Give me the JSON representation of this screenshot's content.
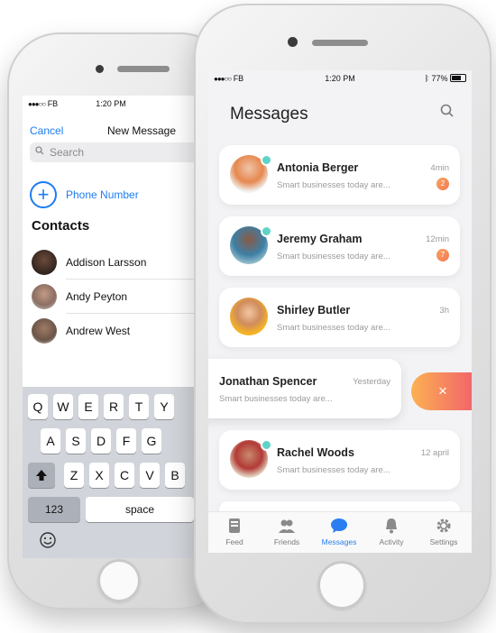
{
  "new_message": {
    "status": {
      "carrier": "FB",
      "time": "1:20 PM"
    },
    "nav": {
      "cancel": "Cancel",
      "title": "New Message"
    },
    "search_placeholder": "Search",
    "phone_number_label": "Phone Number",
    "contacts_heading": "Contacts",
    "contacts": [
      {
        "name": "Addison Larsson"
      },
      {
        "name": "Andy Peyton"
      },
      {
        "name": "Andrew West"
      }
    ],
    "keyboard": {
      "row1": [
        "Q",
        "W",
        "E",
        "R",
        "T",
        "Y"
      ],
      "row2": [
        "A",
        "S",
        "D",
        "F",
        "G"
      ],
      "row3": [
        "Z",
        "X",
        "C",
        "V",
        "B"
      ],
      "numbers_key": "123",
      "space_key": "space"
    }
  },
  "messages": {
    "status": {
      "carrier": "FB",
      "time": "1:20 PM",
      "battery": "77%"
    },
    "title": "Messages",
    "conversations": [
      {
        "name": "Antonia Berger",
        "preview": "Smart businesses today are...",
        "time": "4min",
        "unread": "2"
      },
      {
        "name": "Jeremy Graham",
        "preview": "Smart businesses today are...",
        "time": "12min",
        "unread": "7"
      },
      {
        "name": "Shirley Butler",
        "preview": "Smart businesses today are...",
        "time": "3h",
        "unread": ""
      },
      {
        "name": "Jonathan Spencer",
        "preview": "Smart businesses today are...",
        "time": "Yesterday",
        "unread": ""
      },
      {
        "name": "Rachel Woods",
        "preview": "Smart businesses today are...",
        "time": "12 april",
        "unread": ""
      }
    ],
    "delete_symbol": "×",
    "tabs": [
      {
        "label": "Feed",
        "icon": "feed-icon"
      },
      {
        "label": "Friends",
        "icon": "friends-icon"
      },
      {
        "label": "Messages",
        "icon": "chat-icon"
      },
      {
        "label": "Activity",
        "icon": "bell-icon"
      },
      {
        "label": "Settings",
        "icon": "gear-icon"
      }
    ],
    "colors": {
      "accent": "#2a7ef0",
      "badge": "#f27b55",
      "online": "#5fd3c7",
      "delete_gradient_start": "#fbb152",
      "delete_gradient_end": "#f2636a"
    }
  }
}
